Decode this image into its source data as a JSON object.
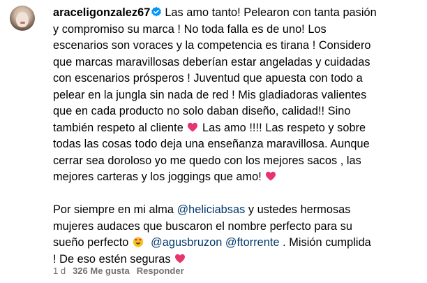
{
  "comment": {
    "username": "araceligonzalez67",
    "verified": true,
    "paragraph1": {
      "l1": "Las amo tanto! Pelearon con tanta pasión",
      "l2": "y compromiso su marca ! No toda falla es de uno! Los",
      "l3": "escenarios son voraces y la competencia es tirana ! Considero",
      "l4": "que marcas maravillosas deberían estar angeladas y cuidadas",
      "l5": "con escenarios prósperos ! Juventud que apuesta con todo a",
      "l6": "pelear en la jungla sin nada de red ! Mis gladiadoras valientes",
      "l7": "que en cada producto no solo daban diseño, calidad!! Sino",
      "l8a": "también respeto al cliente ",
      "l8b": " Las amo !!!! Las respeto y sobre",
      "l9": "todas las cosas todo deja una enseñanza maravillosa. Aunque",
      "l10": "cerrar sea doroloso yo me quedo con los mejores sacos , las",
      "l11": "mejores carteras y los joggings que amo! "
    },
    "paragraph2": {
      "l1a": "Por siempre en mi alma ",
      "mention1": "@heliciabsas",
      "l1b": " y ustedes hermosas",
      "l2": "mujeres audaces que buscaron el nombre perfecto para su",
      "l3a": "sueño perfecto ",
      "mention2": "@agusbruzon",
      "mention3": "@ftorrente",
      "l3b": " . Misión cumplida",
      "l4a": "! De eso estén seguras "
    },
    "emojis": [
      "pink-heart-emoji",
      "pink-heart-emoji",
      "heart-eyes-emoji",
      "pink-heart-emoji"
    ],
    "colors": {
      "mention": "#00376b",
      "meta": "#737373",
      "heart": "#e8336b",
      "verified": "#0095f6"
    }
  },
  "meta": {
    "time": "1 d",
    "likes": "326 Me gusta",
    "reply": "Responder"
  }
}
